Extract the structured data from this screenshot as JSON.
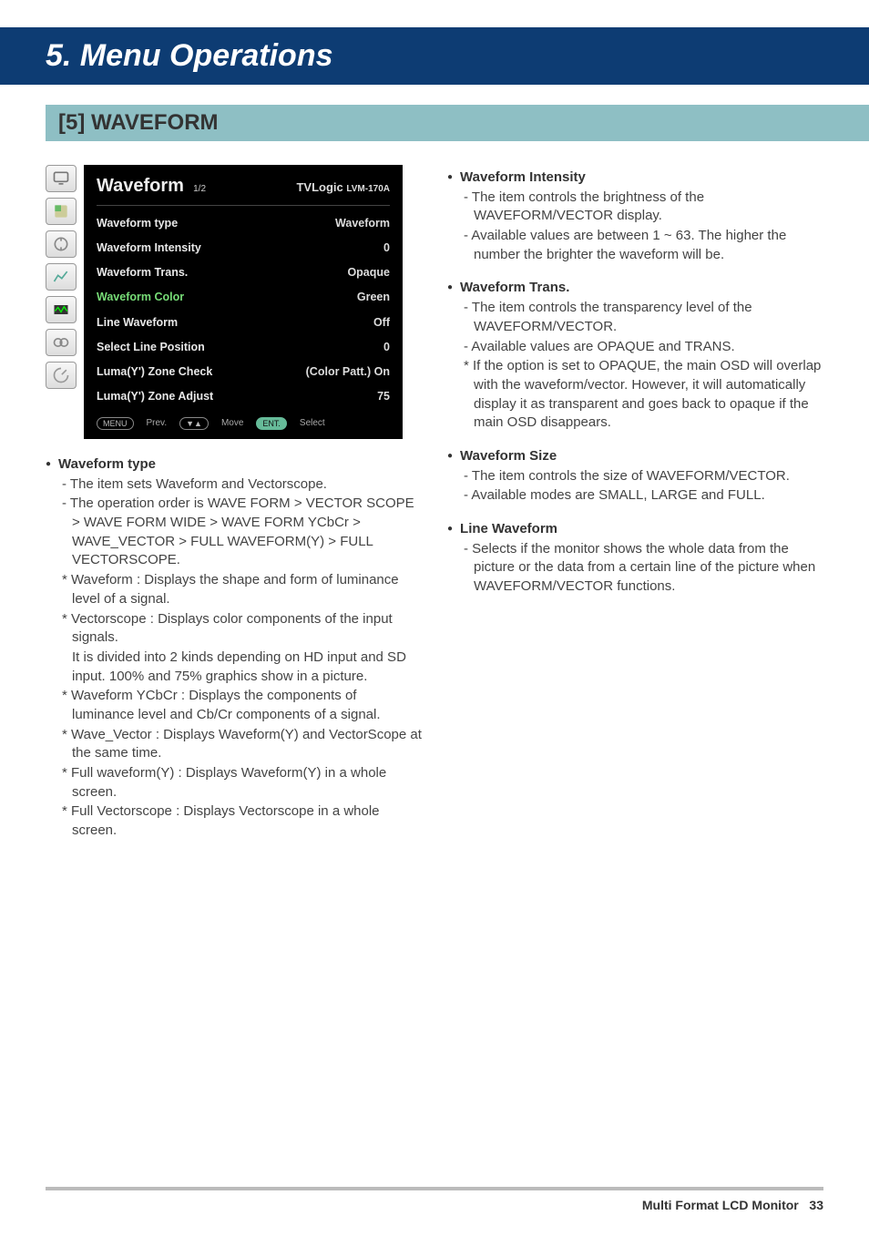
{
  "title": "5. Menu Operations",
  "subtitle": "[5] WAVEFORM",
  "osd": {
    "title": "Waveform",
    "page": "1/2",
    "brand": "TVLogic",
    "model": "LVM-170A",
    "rows": [
      {
        "label": "Waveform type",
        "value": "Waveform"
      },
      {
        "label": "Waveform Intensity",
        "value": "0"
      },
      {
        "label": "Waveform Trans.",
        "value": "Opaque"
      },
      {
        "label": "Waveform Color",
        "value": "Green"
      },
      {
        "label": "Line Waveform",
        "value": "Off"
      },
      {
        "label": "Select Line Position",
        "value": "0"
      },
      {
        "label": "Luma(Y') Zone Check",
        "value": "(Color Patt.) On"
      },
      {
        "label": "Luma(Y') Zone Adjust",
        "value": "75"
      }
    ],
    "hints": {
      "menu": "MENU",
      "prev": "Prev.",
      "move_btn": "▼▲",
      "move": "Move",
      "ent": "ENT.",
      "select": "Select"
    }
  },
  "left": {
    "h": "Waveform type",
    "items": [
      {
        "t": "dash",
        "x": "The item sets Waveform and Vectorscope."
      },
      {
        "t": "dash",
        "x": "The operation order is WAVE FORM > VECTOR SCOPE > WAVE FORM WIDE > WAVE FORM YCbCr > WAVE_VECTOR > FULL WAVEFORM(Y) > FULL VECTORSCOPE."
      },
      {
        "t": "ast",
        "x": "Waveform : Displays the shape and form of luminance level of a signal."
      },
      {
        "t": "ast",
        "x": "Vectorscope : Displays color components of the input signals."
      },
      {
        "t": "cont",
        "x": "It is divided into 2 kinds depending on HD input and SD input. 100% and 75% graphics show in a picture."
      },
      {
        "t": "ast",
        "x": "Waveform YCbCr : Displays the components of luminance level and Cb/Cr components of a signal."
      },
      {
        "t": "ast",
        "x": "Wave_Vector : Displays Waveform(Y) and VectorScope at the same time."
      },
      {
        "t": "ast",
        "x": "Full waveform(Y) : Displays Waveform(Y) in a whole screen."
      },
      {
        "t": "ast",
        "x": "Full Vectorscope : Displays Vectorscope in a whole screen."
      }
    ]
  },
  "right": [
    {
      "h": "Waveform Intensity",
      "items": [
        {
          "t": "dash",
          "x": "The item controls the brightness of the WAVEFORM/VECTOR display."
        },
        {
          "t": "dash",
          "x": "Available values are between 1 ~ 63. The higher the number the brighter the waveform will be."
        }
      ]
    },
    {
      "h": "Waveform Trans.",
      "items": [
        {
          "t": "dash",
          "x": "The item controls the transparency level of the WAVEFORM/VECTOR."
        },
        {
          "t": "dash",
          "x": "Available values are OPAQUE and TRANS."
        },
        {
          "t": "ast",
          "x": "If the option is set to OPAQUE, the main OSD will overlap with the waveform/vector. However, it will automatically display it as transparent and goes back to opaque if the main OSD disappears."
        }
      ]
    },
    {
      "h": "Waveform Size",
      "items": [
        {
          "t": "dash",
          "x": "The item controls the size of WAVEFORM/VECTOR."
        },
        {
          "t": "dash",
          "x": "Available modes are SMALL, LARGE and FULL."
        }
      ]
    },
    {
      "h": "Line Waveform",
      "items": [
        {
          "t": "dash",
          "x": "Selects if the monitor shows the whole data from the picture or the data from a certain line of the picture when WAVEFORM/VECTOR functions."
        }
      ]
    }
  ],
  "footer": {
    "text": "Multi Format LCD Monitor",
    "page": "33"
  }
}
